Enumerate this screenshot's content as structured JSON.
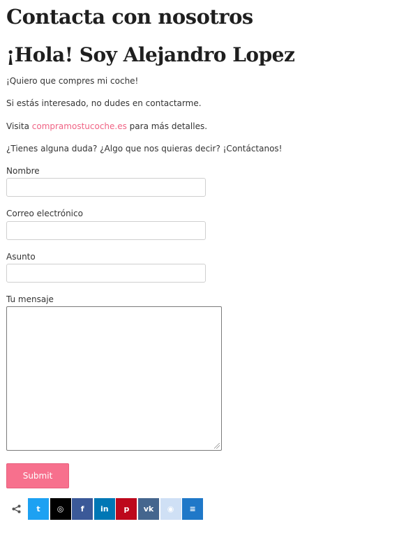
{
  "heading": {
    "title": "Contacta con nosotros",
    "hello": "¡Hola! Soy Alejandro Lopez"
  },
  "intro": {
    "p1": "¡Quiero que compres mi coche!",
    "p2": "Si estás interesado, no dudes en contactarme.",
    "p3_prefix": "Visita ",
    "p3_link": "compramostucoche.es",
    "p3_suffix": " para más detalles.",
    "p4": "¿Tienes alguna duda? ¿Algo que nos quieras decir? ¡Contáctanos!"
  },
  "form": {
    "name_label": "Nombre",
    "name_value": "",
    "email_label": "Correo electrónico",
    "email_value": "",
    "subject_label": "Asunto",
    "subject_value": "",
    "message_label": "Tu mensaje",
    "message_value": "",
    "submit_label": "Submit"
  },
  "share": {
    "buttons": [
      {
        "name": "twitter-icon",
        "glyph": "t",
        "color": "#1da1f2"
      },
      {
        "name": "instagram-icon",
        "glyph": "◎",
        "color": "#000000"
      },
      {
        "name": "facebook-icon",
        "glyph": "f",
        "color": "#3b5998"
      },
      {
        "name": "linkedin-icon",
        "glyph": "in",
        "color": "#0077b5"
      },
      {
        "name": "pinterest-icon",
        "glyph": "p",
        "color": "#bd081c"
      },
      {
        "name": "vk-icon",
        "glyph": "vk",
        "color": "#45668e"
      },
      {
        "name": "reddit-icon",
        "glyph": "◉",
        "color": "#cfe0f5"
      },
      {
        "name": "buffer-icon",
        "glyph": "≡",
        "color": "#1f78c8"
      }
    ]
  }
}
